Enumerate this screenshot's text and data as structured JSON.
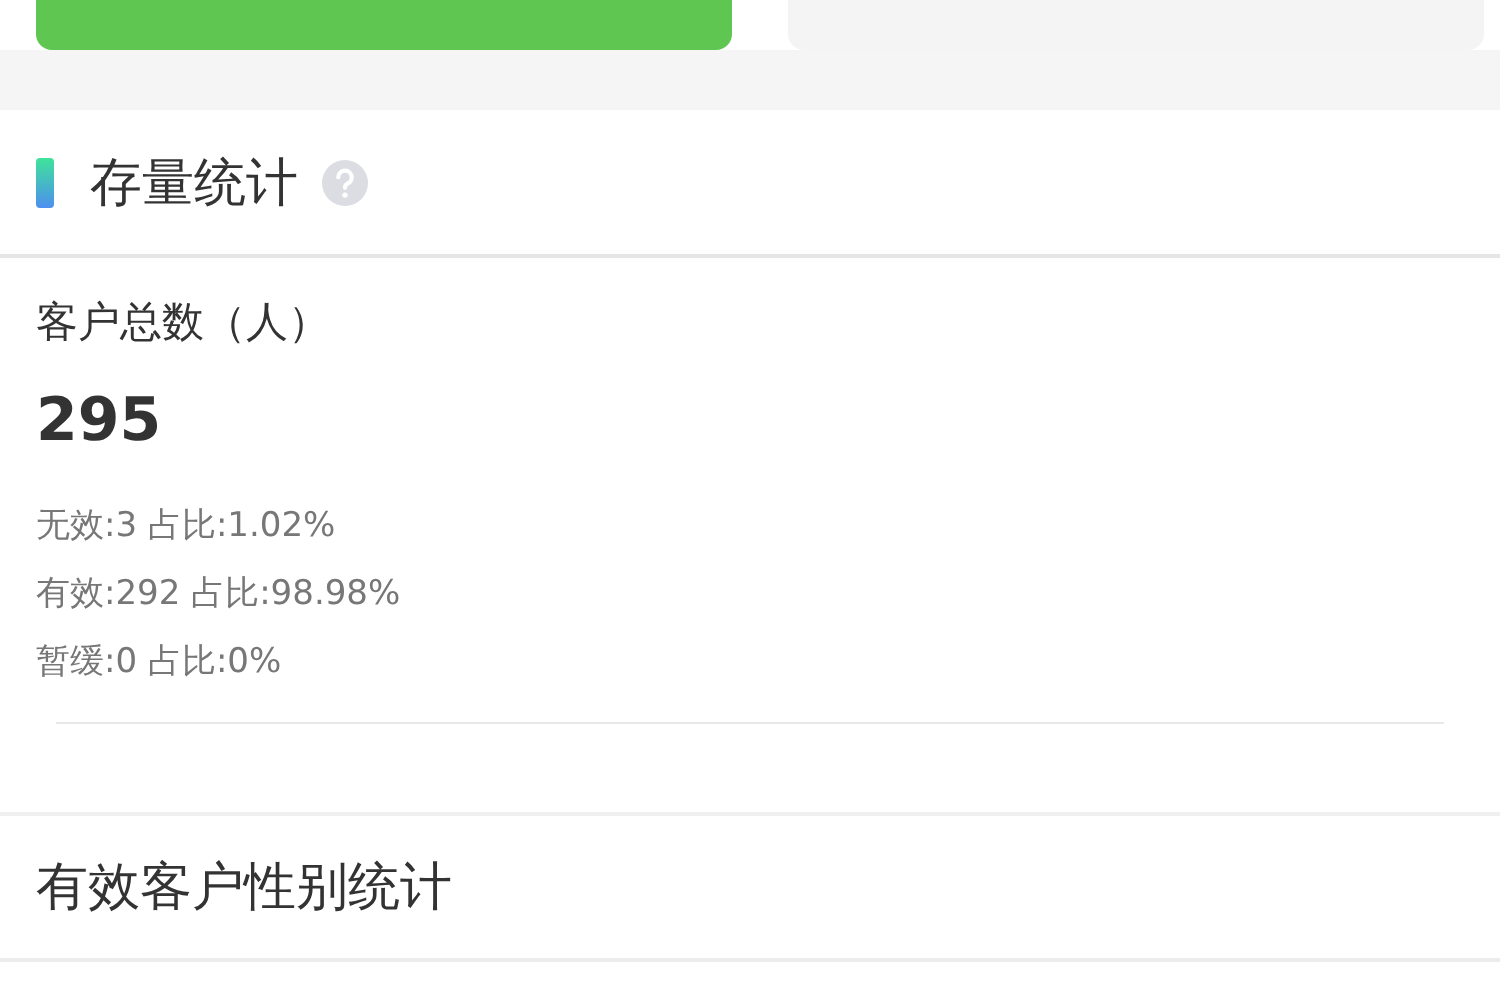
{
  "trend_tabs": [
    {
      "selected": true
    },
    {
      "selected": false
    }
  ],
  "section": {
    "title": "存量统计"
  },
  "total": {
    "label": "客户总数（人）",
    "value": "295",
    "stats": [
      {
        "name": "无效:3",
        "ratio": "占比:1.02%"
      },
      {
        "name": "有效:292",
        "ratio": "占比:98.98%"
      },
      {
        "name": "暂缓:0",
        "ratio": "占比:0%"
      }
    ]
  },
  "gender_section": {
    "title": "有效客户性别统计"
  }
}
